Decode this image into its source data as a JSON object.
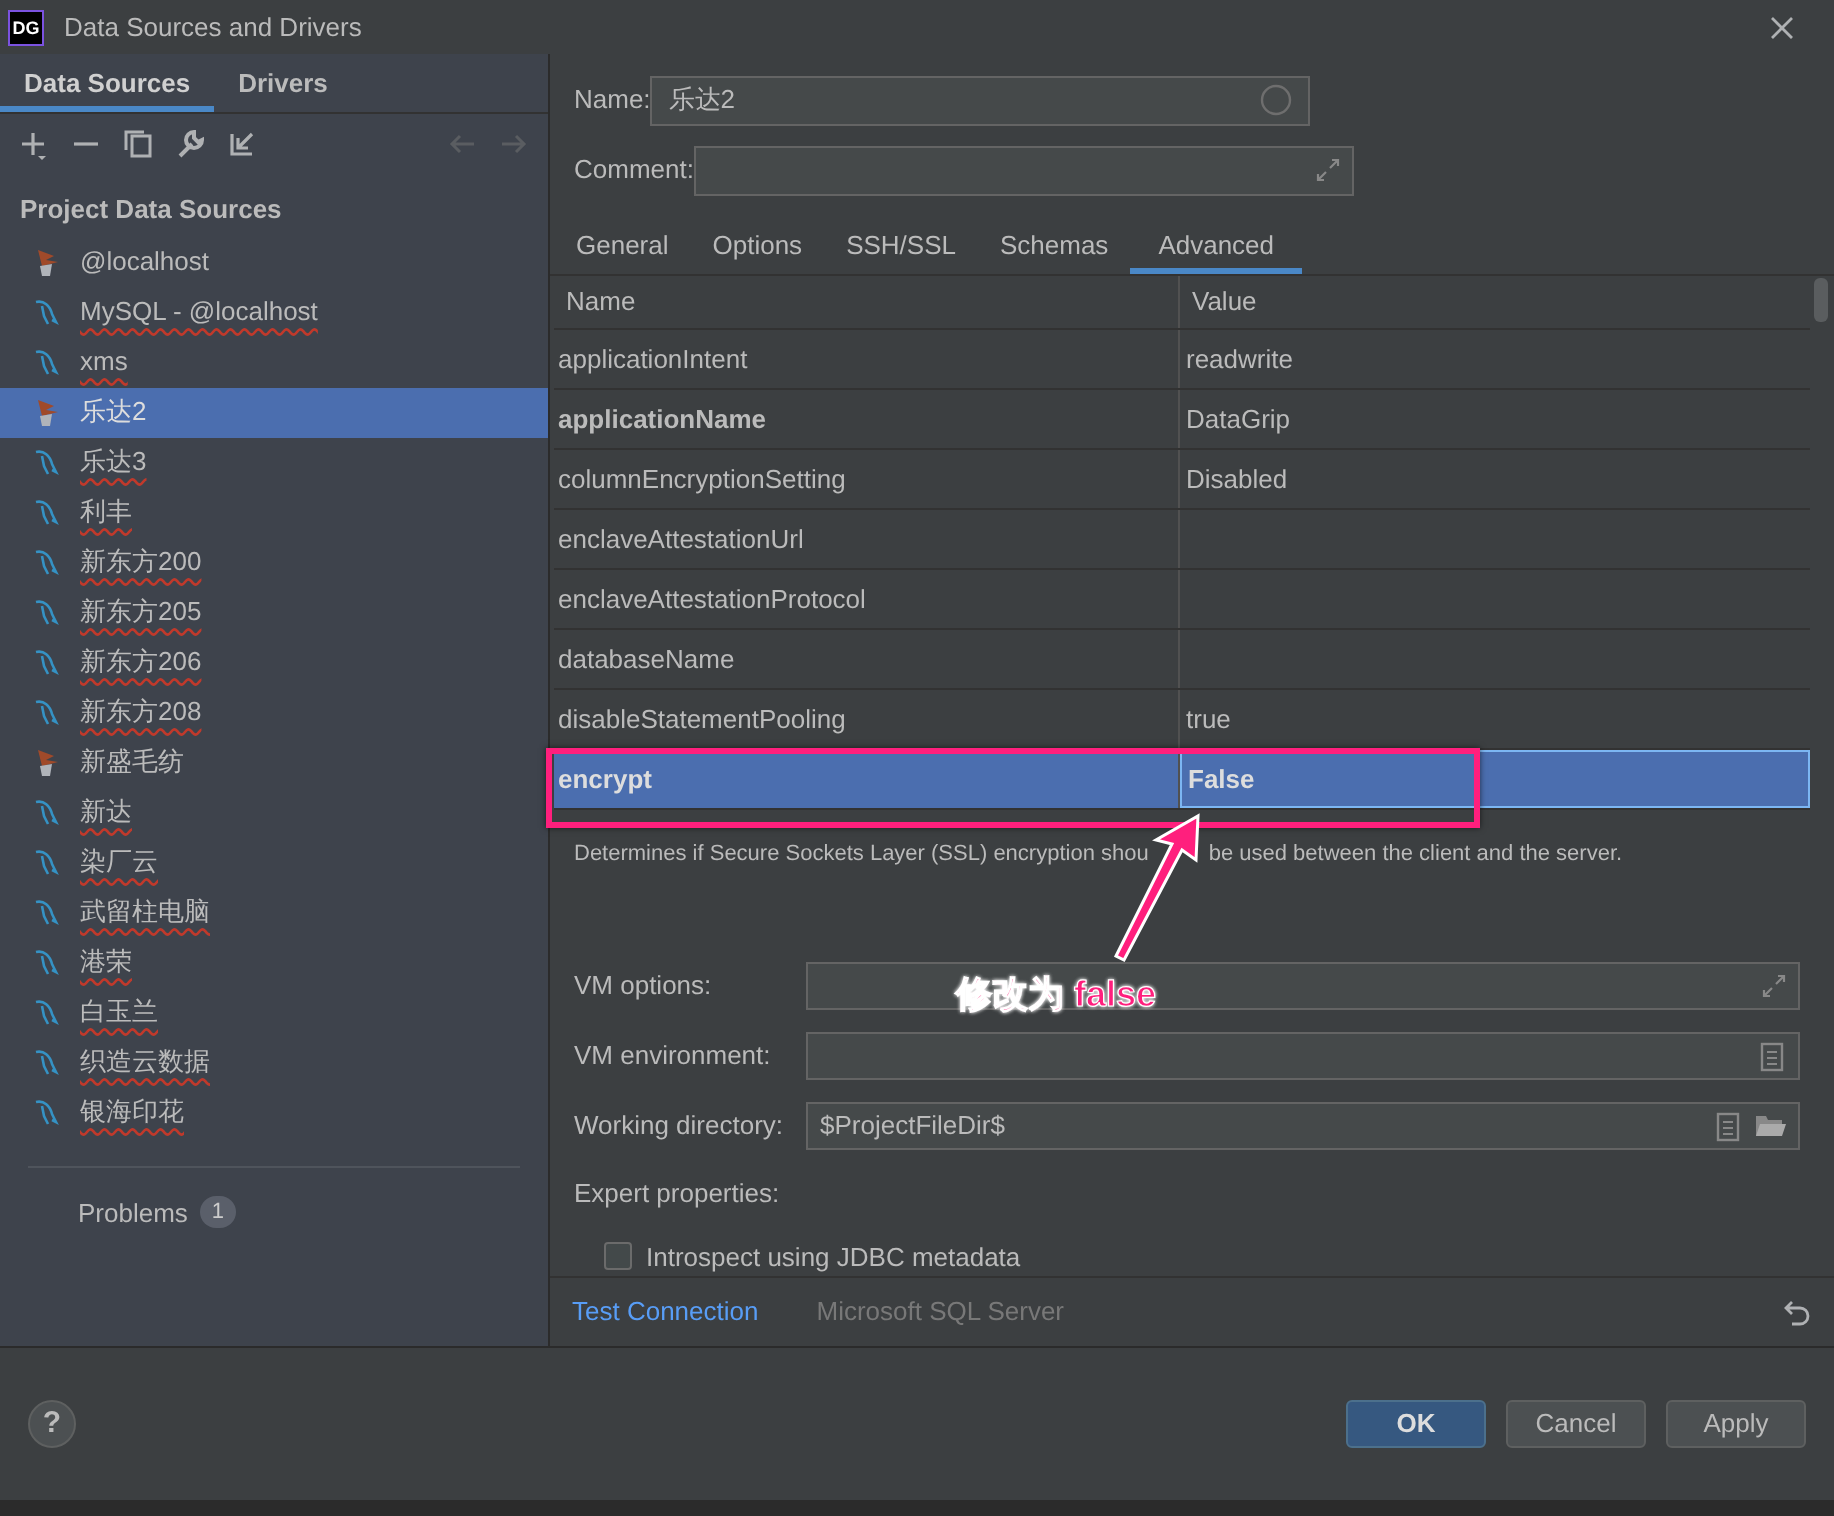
{
  "window": {
    "logo": "DG",
    "title": "Data Sources and Drivers"
  },
  "left_tabs": [
    {
      "label": "Data Sources",
      "selected": true
    },
    {
      "label": "Drivers",
      "selected": false
    }
  ],
  "sidebar": {
    "heading": "Project Data Sources",
    "items": [
      {
        "label": "@localhost",
        "kind": "mssql",
        "selected": false,
        "misspelled": false
      },
      {
        "label": "MySQL - @localhost",
        "kind": "mysql",
        "selected": false,
        "misspelled": true
      },
      {
        "label": "xms",
        "kind": "mysql",
        "selected": false,
        "misspelled": true
      },
      {
        "label": "乐达2",
        "kind": "mssql",
        "selected": true,
        "misspelled": false
      },
      {
        "label": "乐达3",
        "kind": "mysql",
        "selected": false,
        "misspelled": true
      },
      {
        "label": "利丰",
        "kind": "mysql",
        "selected": false,
        "misspelled": true
      },
      {
        "label": "新东方200",
        "kind": "mysql",
        "selected": false,
        "misspelled": true
      },
      {
        "label": "新东方205",
        "kind": "mysql",
        "selected": false,
        "misspelled": true
      },
      {
        "label": "新东方206",
        "kind": "mysql",
        "selected": false,
        "misspelled": true
      },
      {
        "label": "新东方208",
        "kind": "mysql",
        "selected": false,
        "misspelled": true
      },
      {
        "label": "新盛毛纺",
        "kind": "mssql",
        "selected": false,
        "misspelled": false
      },
      {
        "label": "新达",
        "kind": "mysql",
        "selected": false,
        "misspelled": true
      },
      {
        "label": "染厂云",
        "kind": "mysql",
        "selected": false,
        "misspelled": true
      },
      {
        "label": "武留柱电脑",
        "kind": "mysql",
        "selected": false,
        "misspelled": true
      },
      {
        "label": "港荣",
        "kind": "mysql",
        "selected": false,
        "misspelled": true
      },
      {
        "label": "白玉兰",
        "kind": "mysql",
        "selected": false,
        "misspelled": true
      },
      {
        "label": "织造云数据",
        "kind": "mysql",
        "selected": false,
        "misspelled": true
      },
      {
        "label": "银海印花",
        "kind": "mysql",
        "selected": false,
        "misspelled": true
      }
    ],
    "problems": {
      "label": "Problems",
      "count": "1"
    }
  },
  "form": {
    "name_label": "Name:",
    "name_value": "乐达2",
    "comment_label": "Comment:"
  },
  "tabs": [
    {
      "label": "General",
      "selected": false
    },
    {
      "label": "Options",
      "selected": false
    },
    {
      "label": "SSH/SSL",
      "selected": false
    },
    {
      "label": "Schemas",
      "selected": false
    },
    {
      "label": "Advanced",
      "selected": true
    }
  ],
  "table": {
    "columns": [
      "Name",
      "Value"
    ],
    "rows": [
      {
        "name": "applicationIntent",
        "value": "readwrite",
        "modified": false,
        "selected": false
      },
      {
        "name": "applicationName",
        "value": "DataGrip",
        "modified": true,
        "selected": false
      },
      {
        "name": "columnEncryptionSetting",
        "value": "Disabled",
        "modified": false,
        "selected": false
      },
      {
        "name": "enclaveAttestationUrl",
        "value": "",
        "modified": false,
        "selected": false
      },
      {
        "name": "enclaveAttestationProtocol",
        "value": "",
        "modified": false,
        "selected": false
      },
      {
        "name": "databaseName",
        "value": "",
        "modified": false,
        "selected": false
      },
      {
        "name": "disableStatementPooling",
        "value": "true",
        "modified": false,
        "selected": false
      },
      {
        "name": "encrypt",
        "value": "False",
        "modified": true,
        "selected": true
      }
    ]
  },
  "description": [
    "Determines if Secure Sockets Layer (SSL) encryption shou",
    "be used between the client and the server."
  ],
  "annotation": {
    "label": "修改为 false"
  },
  "vm_options": {
    "label": "VM options:"
  },
  "vm_environment": {
    "label": "VM environment:"
  },
  "working_directory": {
    "label": "Working directory:",
    "value": "$ProjectFileDir$"
  },
  "expert": {
    "label": "Expert properties:",
    "checkbox": {
      "label": "Introspect using JDBC metadata",
      "checked": false
    }
  },
  "footer": {
    "test_connection": "Test Connection",
    "driver": "Microsoft SQL Server"
  },
  "help": "?",
  "buttons": [
    {
      "label": "OK",
      "kind": "primary"
    },
    {
      "label": "Cancel",
      "kind": "normal"
    },
    {
      "label": "Apply",
      "kind": "normal"
    }
  ]
}
